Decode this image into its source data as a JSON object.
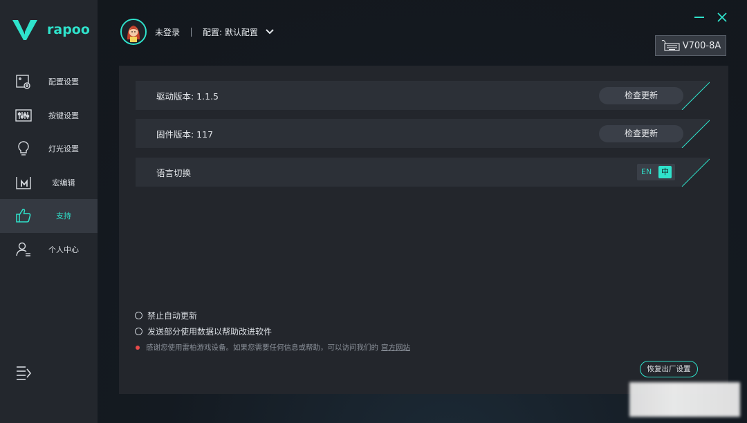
{
  "brand": {
    "logo_text": "rapoo"
  },
  "colors": {
    "accent": "#2fe3cc",
    "sidebar_bg": "#23272d",
    "panel_bg": "#23262c",
    "notice_dot": "#e84a4a"
  },
  "sidebar": {
    "items": [
      {
        "label": "配置设置",
        "icon": "config-icon"
      },
      {
        "label": "按键设置",
        "icon": "keys-icon"
      },
      {
        "label": "灯光设置",
        "icon": "lightbulb-icon"
      },
      {
        "label": "宏编辑",
        "icon": "macro-icon"
      },
      {
        "label": "支持",
        "icon": "thumbs-up-icon",
        "active": true
      },
      {
        "label": "个人中心",
        "icon": "user-icon"
      }
    ],
    "menu_icon": "menu-icon"
  },
  "header": {
    "user_name": "未登录",
    "config_label": "配置: 默认配置",
    "device": "V700-8A"
  },
  "support": {
    "driver_version": "驱动版本: 1.1.5",
    "firmware_version": "固件版本: 117",
    "check_update": "检查更新",
    "language_label": "语言切换",
    "lang_en": "EN",
    "lang_zh": "中"
  },
  "options": {
    "disable_auto_update": "禁止自动更新",
    "send_usage_data": "发送部分使用数据以帮助改进软件",
    "notice": "感谢您使用雷柏游戏设备。如果您需要任何信息或帮助，可以访问我们的",
    "notice_link": "官方网站",
    "reset": "恢复出厂设置"
  }
}
